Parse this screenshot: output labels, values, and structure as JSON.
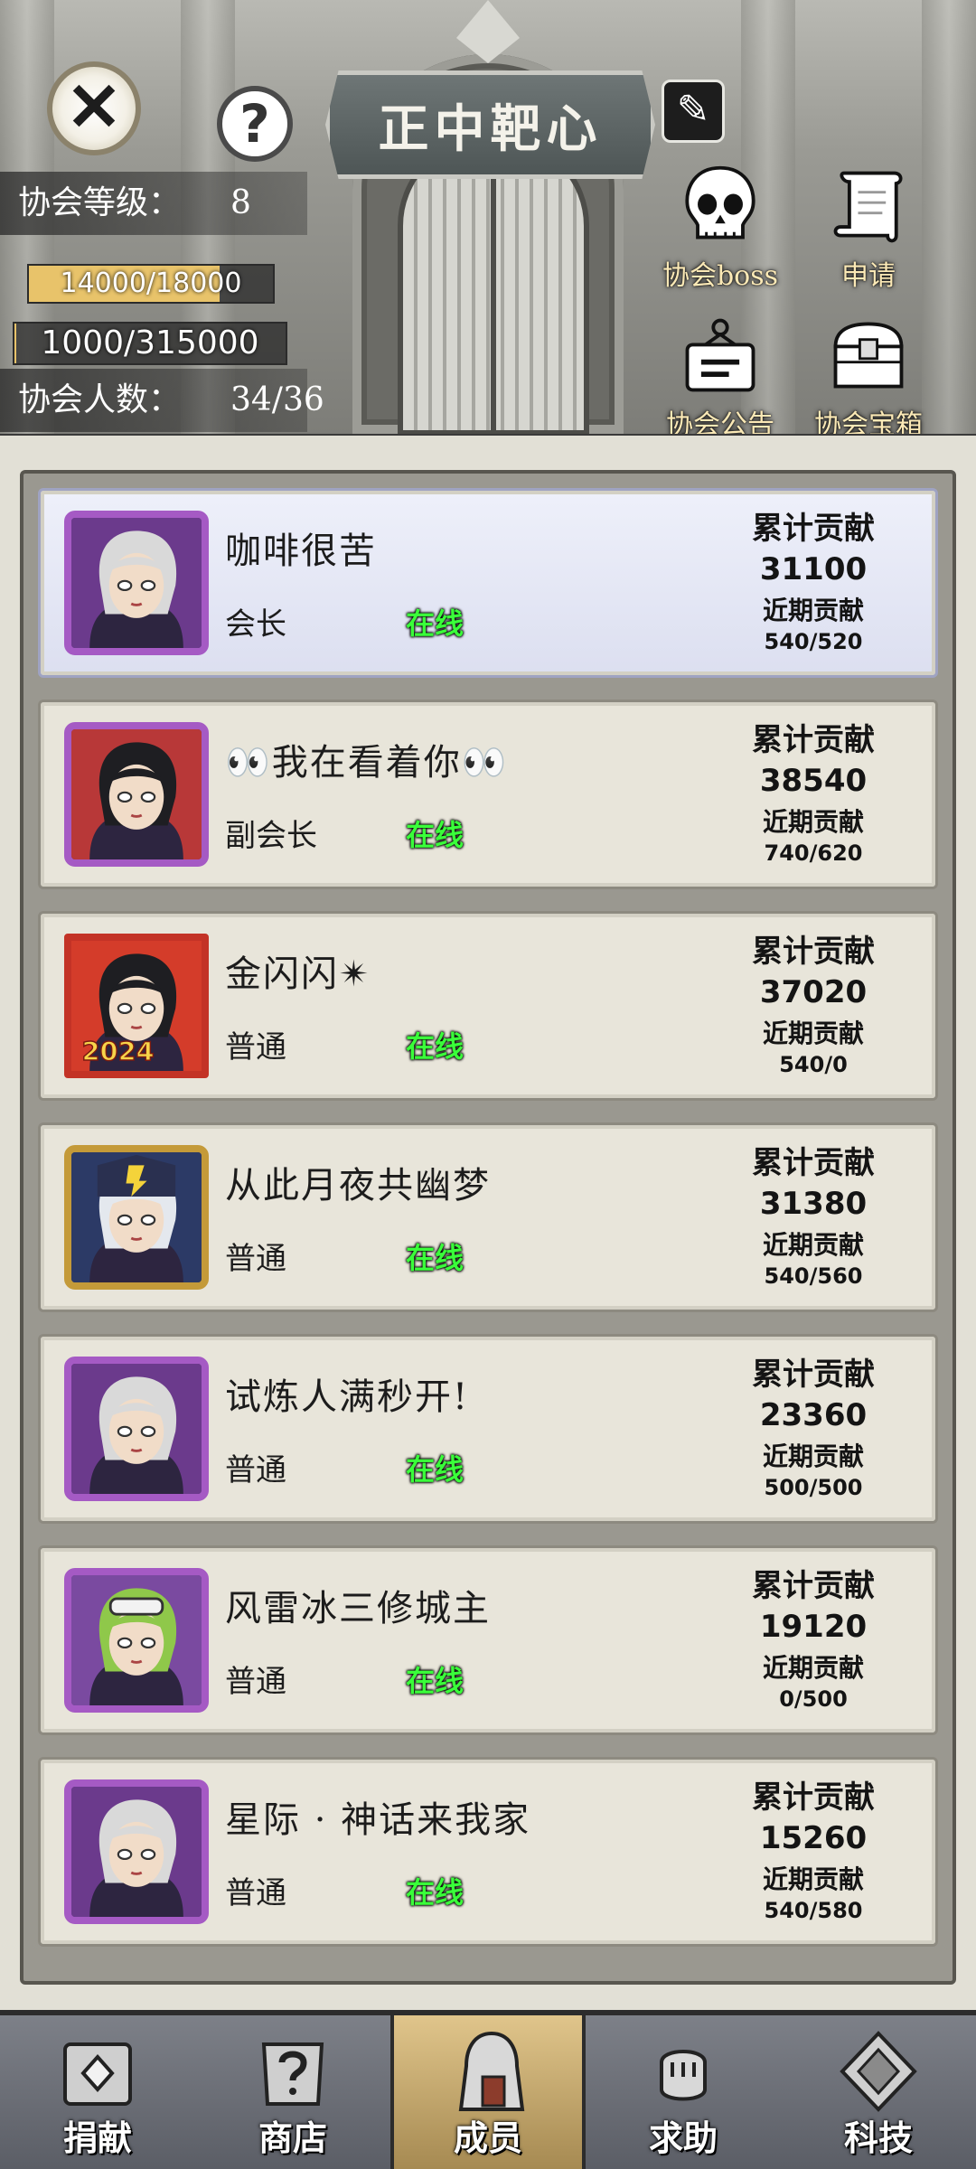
{
  "header": {
    "guild_name": "正中靶心",
    "level_label": "协会等级：",
    "level_value": "8",
    "exp_text": "14000/18000",
    "exp_progress": 0.78,
    "fund_text": "1000/315000",
    "fund_progress": 0.003,
    "members_label": "协会人数：",
    "members_value": "34/36",
    "icons": {
      "close": "close-icon",
      "help": "help-icon",
      "edit": "edit-icon"
    }
  },
  "features": {
    "boss": "协会boss",
    "apply": "申请",
    "notice": "协会公告",
    "chest": "协会宝箱"
  },
  "contrib_labels": {
    "total": "累计贡献",
    "recent": "近期贡献"
  },
  "members": [
    {
      "name": "咖啡很苦",
      "role": "会长",
      "status": "在线",
      "total": "31100",
      "recent": "540/520",
      "avatar": "silver-hair-elf",
      "frame": "purple"
    },
    {
      "name": "👀我在看着你👀",
      "role": "副会长",
      "status": "在线",
      "total": "38540",
      "recent": "740/620",
      "avatar": "black-hair-girl",
      "frame": "purple"
    },
    {
      "name": "金闪闪✴",
      "role": "普通",
      "status": "在线",
      "total": "37020",
      "recent": "540/0",
      "avatar": "black-hair-girl-2024",
      "frame": "red",
      "badge": "2024"
    },
    {
      "name": "从此月夜共幽梦",
      "role": "普通",
      "status": "在线",
      "total": "31380",
      "recent": "540/560",
      "avatar": "white-hair-hood",
      "frame": "gold"
    },
    {
      "name": "试炼人满秒开!",
      "role": "普通",
      "status": "在线",
      "total": "23360",
      "recent": "500/500",
      "avatar": "silver-hair-elf",
      "frame": "purple"
    },
    {
      "name": "风雷冰三修城主",
      "role": "普通",
      "status": "在线",
      "total": "19120",
      "recent": "0/500",
      "avatar": "green-hair-goggles",
      "frame": "purple"
    },
    {
      "name": "星际 · 神话来我家",
      "role": "普通",
      "status": "在线",
      "total": "15260",
      "recent": "540/580",
      "avatar": "silver-hair-elf",
      "frame": "purple"
    }
  ],
  "nav": [
    {
      "label": "捐献",
      "icon": "donate-icon"
    },
    {
      "label": "商店",
      "icon": "shop-icon"
    },
    {
      "label": "成员",
      "icon": "members-icon",
      "active": true
    },
    {
      "label": "求助",
      "icon": "help-fist-icon"
    },
    {
      "label": "科技",
      "icon": "tech-icon"
    }
  ],
  "colors": {
    "online": "#3aff3a",
    "frame_purple": "#a55ac4",
    "frame_gold": "#c49a39",
    "nav_active": "#e0c58b"
  }
}
